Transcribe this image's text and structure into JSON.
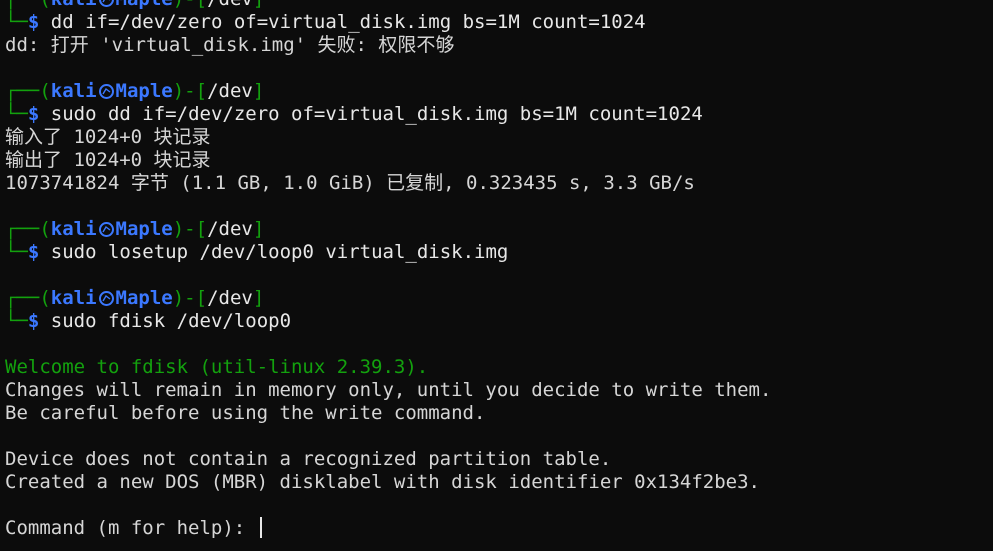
{
  "prompt": {
    "user": "kali",
    "host": "Maple",
    "dir": "/dev",
    "symbol": "$"
  },
  "session": {
    "cmd1": "dd if=/dev/zero of=virtual_disk.img bs=1M count=1024",
    "out1": "dd: 打开 'virtual_disk.img' 失败: 权限不够",
    "cmd2": "sudo dd if=/dev/zero of=virtual_disk.img bs=1M count=1024",
    "out2a": "输入了 1024+0 块记录",
    "out2b": "输出了 1024+0 块记录",
    "out2c": "1073741824 字节 (1.1 GB, 1.0 GiB) 已复制, 0.323435 s, 3.3 GB/s",
    "cmd3": "sudo losetup /dev/loop0 virtual_disk.img",
    "cmd4": "sudo fdisk /dev/loop0",
    "fdisk_welcome": "Welcome to fdisk (util-linux 2.39.3).",
    "fdisk_l1": "Changes will remain in memory only, until you decide to write them.",
    "fdisk_l2": "Be careful before using the write command.",
    "fdisk_l3": "Device does not contain a recognized partition table.",
    "fdisk_l4": "Created a new DOS (MBR) disklabel with disk identifier 0x134f2be3.",
    "command_prompt": "Command (m for help): "
  },
  "colors": {
    "background": "#0c0c0c",
    "green": "#13a10e",
    "blue": "#3b78ff",
    "text": "#d6d6d6"
  },
  "icons": {
    "prompt_separator": "kali-dragon-icon"
  }
}
